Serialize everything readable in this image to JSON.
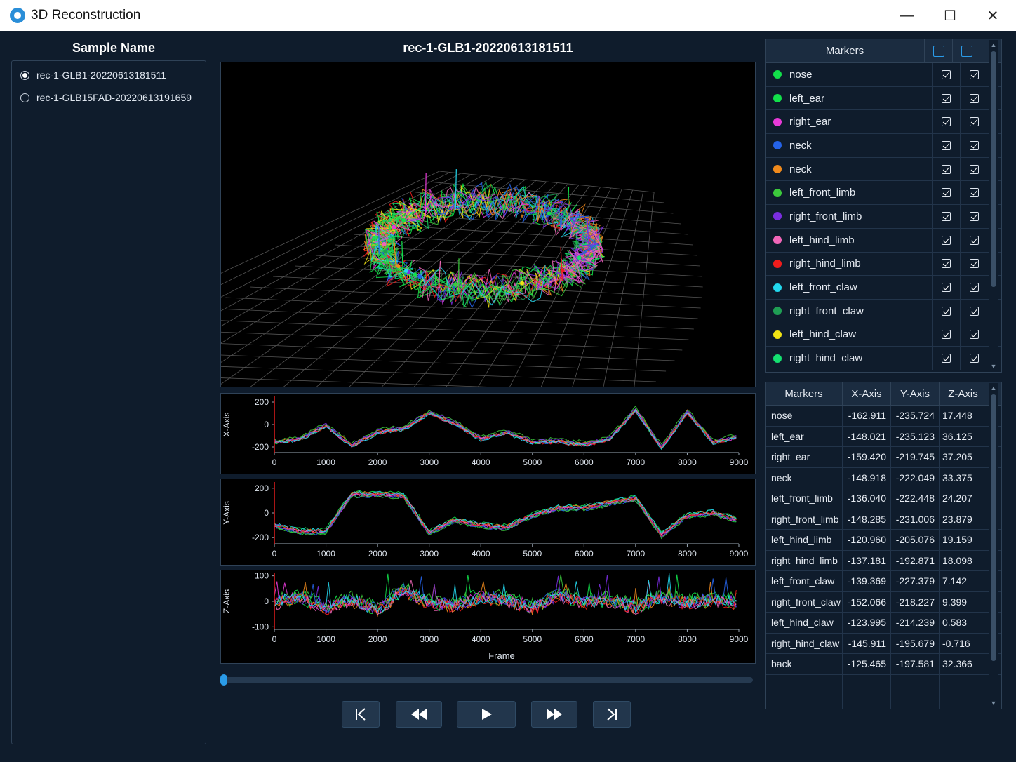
{
  "window": {
    "title": "3D Reconstruction",
    "minimize": "—",
    "maximize": "☐",
    "close": "✕"
  },
  "samples": {
    "title": "Sample Name",
    "items": [
      {
        "label": "rec-1-GLB1-20220613181511",
        "selected": true
      },
      {
        "label": "rec-1-GLB15FAD-20220613191659",
        "selected": false
      }
    ]
  },
  "viewer": {
    "title": "rec-1-GLB1-20220613181511"
  },
  "plots": {
    "x_ticks": [
      "0",
      "1000",
      "2000",
      "3000",
      "4000",
      "5000",
      "6000",
      "7000",
      "8000",
      "9000"
    ],
    "xy_yticks": [
      "200",
      "0",
      "-200"
    ],
    "z_yticks": [
      "100",
      "0",
      "-100"
    ],
    "xlabel": "Frame",
    "x_axis": {
      "ylabel": "X-Axis"
    },
    "y_axis": {
      "ylabel": "Y-Axis"
    },
    "z_axis": {
      "ylabel": "Z-Axis"
    }
  },
  "chart_data": [
    {
      "type": "line",
      "ylabel": "X-Axis",
      "xlabel": "",
      "xlim": [
        0,
        9000
      ],
      "ylim": [
        -250,
        250
      ],
      "x": [
        0,
        500,
        1000,
        1500,
        2000,
        2500,
        3000,
        3500,
        4000,
        4500,
        5000,
        5500,
        6000,
        6500,
        7000,
        7500,
        8000,
        8500,
        9000
      ],
      "series": [
        {
          "values": [
            -150,
            -120,
            0,
            -180,
            -60,
            -30,
            110,
            20,
            -120,
            -60,
            -150,
            -140,
            -170,
            -120,
            140,
            -200,
            120,
            -150,
            -100
          ]
        }
      ]
    },
    {
      "type": "line",
      "ylabel": "Y-Axis",
      "xlabel": "",
      "xlim": [
        0,
        9000
      ],
      "ylim": [
        -250,
        250
      ],
      "x": [
        0,
        500,
        1000,
        1500,
        2000,
        2500,
        3000,
        3500,
        4000,
        4500,
        5000,
        5500,
        6000,
        6500,
        7000,
        7500,
        8000,
        8500,
        9000
      ],
      "series": [
        {
          "values": [
            -100,
            -150,
            -150,
            150,
            150,
            140,
            -160,
            -60,
            -100,
            -120,
            -20,
            40,
            40,
            80,
            120,
            -180,
            -20,
            0,
            -60
          ]
        }
      ]
    },
    {
      "type": "line",
      "ylabel": "Z-Axis",
      "xlabel": "Frame",
      "xlim": [
        0,
        9000
      ],
      "ylim": [
        -110,
        110
      ],
      "x": [
        0,
        500,
        1000,
        1500,
        2000,
        2500,
        3000,
        3500,
        4000,
        4500,
        5000,
        5500,
        6000,
        6500,
        7000,
        7500,
        8000,
        8500,
        9000
      ],
      "series": [
        {
          "values": [
            0,
            20,
            -20,
            10,
            -30,
            50,
            0,
            -10,
            20,
            10,
            -20,
            30,
            0,
            10,
            -20,
            20,
            0,
            10,
            0
          ]
        }
      ]
    }
  ],
  "markers": {
    "title": "Markers",
    "items": [
      {
        "name": "nose",
        "color": "#12e04a"
      },
      {
        "name": "left_ear",
        "color": "#12e04a"
      },
      {
        "name": "right_ear",
        "color": "#e83ad8"
      },
      {
        "name": "neck",
        "color": "#2563e8"
      },
      {
        "name": "neck",
        "color": "#f08a1c"
      },
      {
        "name": "left_front_limb",
        "color": "#3cc93c"
      },
      {
        "name": "right_front_limb",
        "color": "#7a2ee0"
      },
      {
        "name": "left_hind_limb",
        "color": "#f066b8"
      },
      {
        "name": "right_hind_limb",
        "color": "#f01c1c"
      },
      {
        "name": "left_front_claw",
        "color": "#22d8ee"
      },
      {
        "name": "right_front_claw",
        "color": "#1f9e54"
      },
      {
        "name": "left_hind_claw",
        "color": "#f2e414"
      },
      {
        "name": "right_hind_claw",
        "color": "#14e070"
      }
    ]
  },
  "coords": {
    "headers": [
      "Markers",
      "X-Axis",
      "Y-Axis",
      "Z-Axis"
    ],
    "rows": [
      [
        "nose",
        "-162.911",
        "-235.724",
        "17.448"
      ],
      [
        "left_ear",
        "-148.021",
        "-235.123",
        "36.125"
      ],
      [
        "right_ear",
        "-159.420",
        "-219.745",
        "37.205"
      ],
      [
        "neck",
        "-148.918",
        "-222.049",
        "33.375"
      ],
      [
        "left_front_limb",
        "-136.040",
        "-222.448",
        "24.207"
      ],
      [
        "right_front_limb",
        "-148.285",
        "-231.006",
        "23.879"
      ],
      [
        "left_hind_limb",
        "-120.960",
        "-205.076",
        "19.159"
      ],
      [
        "right_hind_limb",
        "-137.181",
        "-192.871",
        "18.098"
      ],
      [
        "left_front_claw",
        "-139.369",
        "-227.379",
        "7.142"
      ],
      [
        "right_front_claw",
        "-152.066",
        "-218.227",
        "9.399"
      ],
      [
        "left_hind_claw",
        "-123.995",
        "-214.239",
        "0.583"
      ],
      [
        "right_hind_claw",
        "-145.911",
        "-195.679",
        "-0.716"
      ],
      [
        "back",
        "-125.465",
        "-197.581",
        "32.366"
      ]
    ]
  },
  "playback": {
    "progress": 0.0
  },
  "icons": {
    "app": "app-logo-icon",
    "list_toggle": "list-icon",
    "settings_toggle": "settings-icon"
  }
}
